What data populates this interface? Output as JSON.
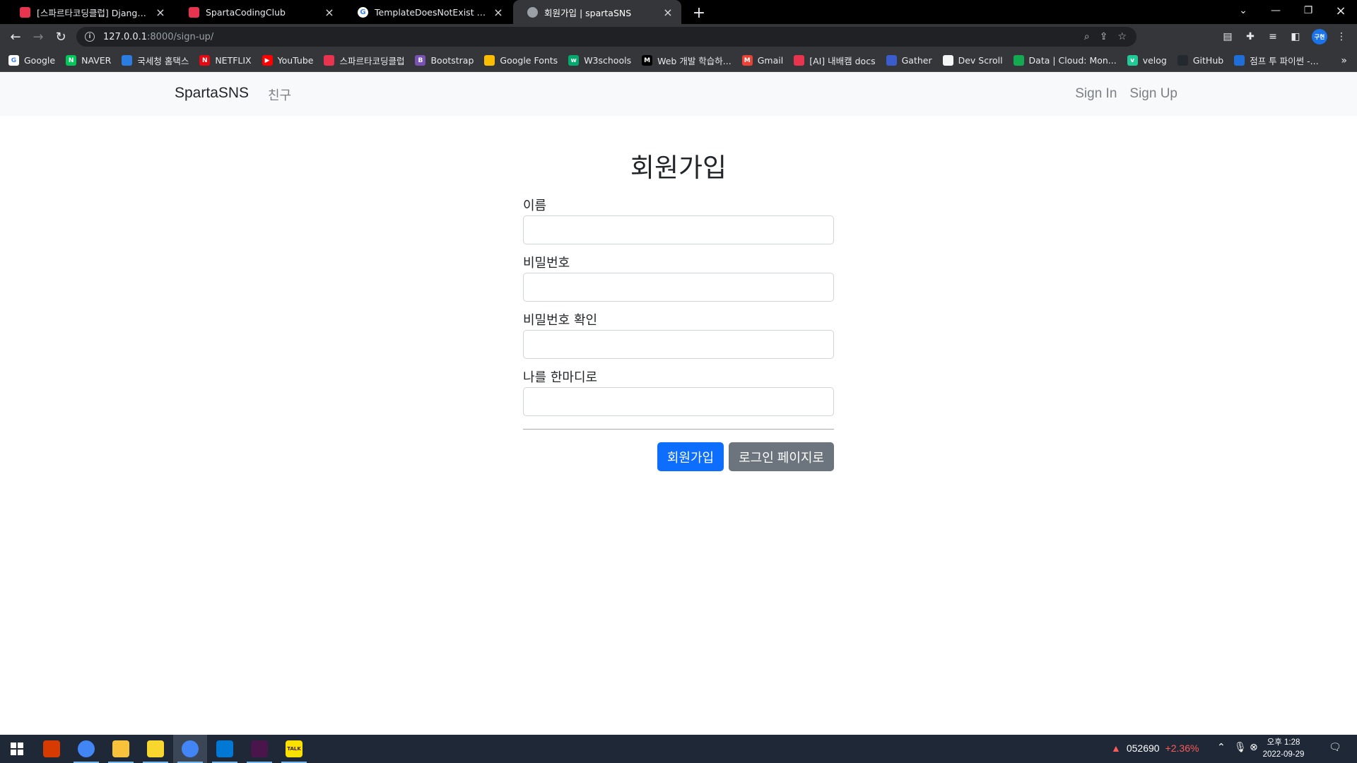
{
  "browser": {
    "tabs": [
      {
        "title": "[스파르타코딩클럽] Django 기초",
        "favicon_color": "#e8344e",
        "favicon_glyph": ""
      },
      {
        "title": "SpartaCodingClub",
        "favicon_color": "#e8344e",
        "favicon_glyph": ""
      },
      {
        "title": "TemplateDoesNotExist - Google",
        "favicon_color": "#ffffff",
        "favicon_glyph": "G"
      },
      {
        "title": "회원가입 | spartaSNS",
        "favicon_color": "#9aa0a6",
        "favicon_glyph": ""
      }
    ],
    "active_tab": 3,
    "url_host": "127.0.0.1",
    "url_path": ":8000/sign-up/",
    "profile_initials": "구현",
    "bookmarks": [
      {
        "label": "Google",
        "color": "#ffffff",
        "glyph": "G"
      },
      {
        "label": "NAVER",
        "color": "#03c75a",
        "glyph": "N"
      },
      {
        "label": "국세청 홈택스",
        "color": "#2a7de1",
        "glyph": ""
      },
      {
        "label": "NETFLIX",
        "color": "#e50914",
        "glyph": "N"
      },
      {
        "label": "YouTube",
        "color": "#ff0000",
        "glyph": "▶"
      },
      {
        "label": "스파르타코딩클럽",
        "color": "#e8344e",
        "glyph": ""
      },
      {
        "label": "Bootstrap",
        "color": "#7952b3",
        "glyph": "B"
      },
      {
        "label": "Google Fonts",
        "color": "#fbbc04",
        "glyph": ""
      },
      {
        "label": "W3schools",
        "color": "#04aa6d",
        "glyph": "w"
      },
      {
        "label": "Web 개발 학습하...",
        "color": "#000000",
        "glyph": "M"
      },
      {
        "label": "Gmail",
        "color": "#ea4335",
        "glyph": "M"
      },
      {
        "label": "[AI] 내배캠 docs",
        "color": "#e8344e",
        "glyph": ""
      },
      {
        "label": "Gather",
        "color": "#3b5ccc",
        "glyph": ""
      },
      {
        "label": "Dev Scroll",
        "color": "#f5f5f5",
        "glyph": ""
      },
      {
        "label": "Data | Cloud: Mon...",
        "color": "#13aa52",
        "glyph": ""
      },
      {
        "label": "velog",
        "color": "#20c997",
        "glyph": "v"
      },
      {
        "label": "GitHub",
        "color": "#24292f",
        "glyph": ""
      },
      {
        "label": "점프 투 파이썬 -...",
        "color": "#1e6fd9",
        "glyph": ""
      }
    ]
  },
  "app": {
    "brand": "SpartaSNS",
    "nav_friends": "친구",
    "nav_sign_in": "Sign In",
    "nav_sign_up": "Sign Up"
  },
  "form": {
    "title": "회원가입",
    "fields": [
      {
        "label": "이름",
        "value": ""
      },
      {
        "label": "비밀번호",
        "value": ""
      },
      {
        "label": "비밀번호 확인",
        "value": ""
      },
      {
        "label": "나를 한마디로",
        "value": ""
      }
    ],
    "submit_label": "회원가입",
    "login_label": "로그인 페이지로"
  },
  "taskbar": {
    "stock_code": "052690",
    "stock_change": "+2.36%",
    "clock_time": "오후 1:28",
    "clock_date": "2022-09-29",
    "apps": [
      {
        "name": "office",
        "color": "#d83b01",
        "glyph": ""
      },
      {
        "name": "chrome",
        "color": "#4285f4",
        "glyph": ""
      },
      {
        "name": "file-explorer",
        "color": "#f8c23a",
        "glyph": ""
      },
      {
        "name": "sticky-notes",
        "color": "#f7d62e",
        "glyph": ""
      },
      {
        "name": "chrome-profile",
        "color": "#4285f4",
        "glyph": ""
      },
      {
        "name": "vscode",
        "color": "#0078d4",
        "glyph": ""
      },
      {
        "name": "slack",
        "color": "#4a154b",
        "glyph": ""
      },
      {
        "name": "kakaotalk",
        "color": "#fae100",
        "glyph": "TALK"
      }
    ]
  }
}
